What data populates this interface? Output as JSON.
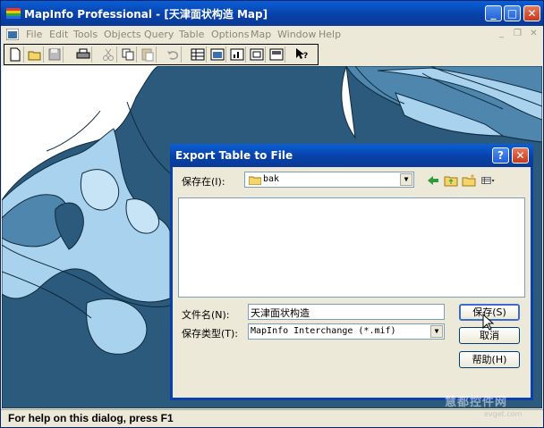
{
  "window": {
    "title": "MapInfo Professional - [天津面状构造 Map]",
    "minimize_glyph": "_",
    "maximize_glyph": "□",
    "close_glyph": "✕"
  },
  "menu": {
    "items": [
      "File",
      "Edit",
      "Tools",
      "Objects",
      "Query",
      "Table",
      "Options",
      "Map",
      "Window",
      "Help"
    ]
  },
  "toolbar": {
    "icons": [
      "new-icon",
      "open-icon",
      "save-icon",
      "print-icon",
      "cut-icon",
      "copy-icon",
      "paste-icon",
      "undo-icon",
      "new-browser-icon",
      "new-mapper-icon",
      "new-grapher-icon",
      "new-layout-icon",
      "redistrict-icon",
      "help-pointer-icon"
    ]
  },
  "dialog": {
    "title": "Export Table to File",
    "help_glyph": "?",
    "close_glyph": "✕",
    "save_in_label": "保存在(I):",
    "save_in_value": "bak",
    "file_name_label": "文件名(N):",
    "file_name_value": "天津面状构造",
    "file_type_label": "保存类型(T):",
    "file_type_value": "MapInfo Interchange (*.mif)",
    "save_button": "保存(S)",
    "cancel_button": "取消",
    "help_button": "帮助(H)"
  },
  "status": {
    "text": "For help on this dialog, press F1"
  },
  "watermark": {
    "text": "慧都控件网",
    "sub": "evget.com"
  },
  "colors": {
    "map_dark": "#2b5a7c",
    "map_mid": "#4f86ad",
    "map_light": "#a8d2ee",
    "titlebar": "#0a4fc4"
  }
}
